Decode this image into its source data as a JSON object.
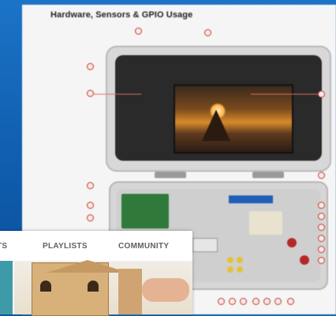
{
  "document": {
    "title": "Hardware, Sensors & GPIO Usage"
  },
  "overlay": {
    "tabs": [
      {
        "label": "TS"
      },
      {
        "label": "PLAYLISTS"
      },
      {
        "label": "COMMUNITY"
      }
    ]
  },
  "colors": {
    "desktop": "#1b73c7",
    "callout": "#c0392b"
  }
}
